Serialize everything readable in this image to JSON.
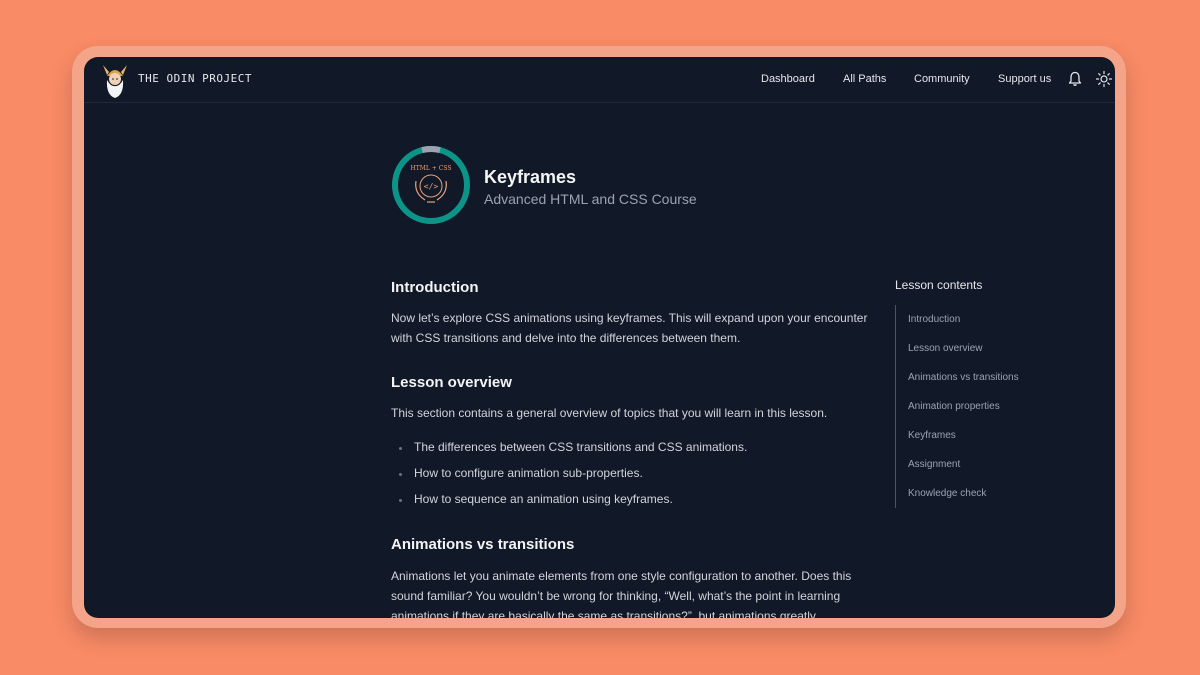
{
  "header": {
    "brand": "THE ODIN PROJECT",
    "nav": [
      "Dashboard",
      "All Paths",
      "Community",
      "Support us"
    ],
    "icons": [
      "bell-icon",
      "sun-icon"
    ]
  },
  "lesson": {
    "badge_text": "HTML + CSS",
    "title": "Keyframes",
    "course": "Advanced HTML and CSS Course",
    "progress_fraction": 0.08
  },
  "content": {
    "intro_heading": "Introduction",
    "intro_text": "Now let’s explore CSS animations using keyframes. This will expand upon your encounter with CSS transitions and delve into the differences between them.",
    "overview_heading": "Lesson overview",
    "overview_text": "This section contains a general overview of topics that you will learn in this lesson.",
    "overview_items": [
      "The differences between CSS transitions and CSS animations.",
      "How to configure animation sub-properties.",
      "How to sequence an animation using keyframes."
    ],
    "anim_heading": "Animations vs transitions",
    "anim_text": "Animations let you animate elements from one style configuration to another. Does this sound familiar? You wouldn’t be wrong for thinking, “Well, what’s the point in learning animations if they are basically the same as transitions?”, but animations greatly"
  },
  "toc": {
    "title": "Lesson contents",
    "items": [
      "Introduction",
      "Lesson overview",
      "Animations vs transitions",
      "Animation properties",
      "Keyframes",
      "Assignment",
      "Knowledge check"
    ]
  },
  "colors": {
    "background": "#f98b66",
    "window": "#111827",
    "accent": "#0d9488"
  }
}
